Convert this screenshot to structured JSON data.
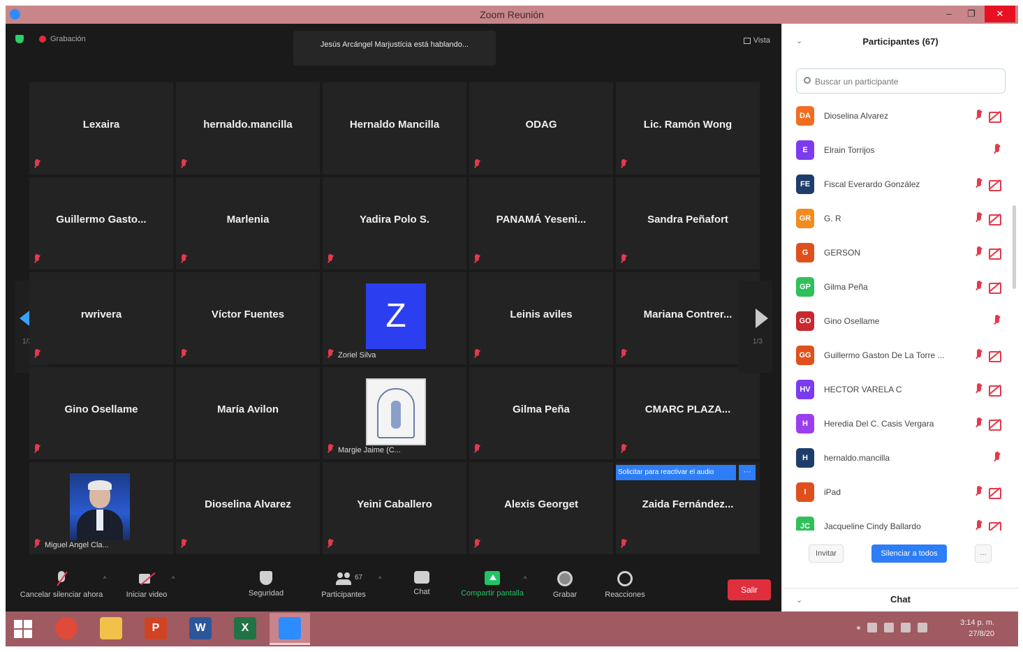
{
  "window": {
    "title": "Zoom Reunión",
    "minimize": "–",
    "restore": "❐",
    "close": "✕"
  },
  "meeting": {
    "recording_label": "Grabación",
    "speaker_banner": "Jesús Arcángel Marjustícia está hablando...",
    "view_label": "Vista",
    "page_indicator_prev": "1/3",
    "page_indicator_next": "1/3",
    "tiles": [
      {
        "name": "Lexaira"
      },
      {
        "name": "hernaldo.mancilla"
      },
      {
        "name": "Hernaldo Mancilla"
      },
      {
        "name": "ODAG"
      },
      {
        "name": "Lic. Ramón Wong"
      },
      {
        "name": "Guillermo Gasto..."
      },
      {
        "name": "Marlenia"
      },
      {
        "name": "Yadira Polo S."
      },
      {
        "name": "PANAMÁ Yeseni..."
      },
      {
        "name": "Sandra Peñafort"
      },
      {
        "name": "rwrivera"
      },
      {
        "name": "Víctor Fuentes"
      },
      {
        "avatar_letter": "Z",
        "small_name": "Zoriel Silva"
      },
      {
        "name": "Leinis aviles"
      },
      {
        "name": "Mariana Contrer..."
      },
      {
        "name": "Gino Osellame"
      },
      {
        "name": "María Avilon"
      },
      {
        "small_name": "Margie Jaime (C..."
      },
      {
        "name": "Gilma Peña"
      },
      {
        "name": "CMARC PLAZA..."
      },
      {
        "small_name": "Miguel Angel Cla..."
      },
      {
        "name": "Dioselina Alvarez"
      },
      {
        "name": "Yeini Caballero"
      },
      {
        "name": "Alexis Georget"
      },
      {
        "name": "Zaida Fernández...",
        "request_text": "Solicitar para reactivar el audio",
        "request_more": "···"
      }
    ]
  },
  "toolbar": {
    "mute_label": "Cancelar silenciar ahora",
    "video_label": "Iniciar video",
    "security_label": "Seguridad",
    "participants_label": "Participantes",
    "participants_count": "67",
    "chat_label": "Chat",
    "share_label": "Compartir pantalla",
    "record_label": "Grabar",
    "reactions_label": "Reacciones",
    "leave_label": "Salir",
    "caret": "^"
  },
  "panel": {
    "chevron": "⌄",
    "title": "Participantes (67)",
    "search_placeholder": "Buscar un participante",
    "participants": [
      {
        "initials": "DA",
        "name": "Dioselina Alvarez",
        "color": "#f26d21",
        "video_off": true
      },
      {
        "initials": "E",
        "name": "Elrain Torrijos",
        "color": "#7b3cf0",
        "video_off": false
      },
      {
        "initials": "FE",
        "name": "Fiscal Everardo González",
        "color": "#1f3d6b",
        "video_off": true
      },
      {
        "initials": "GR",
        "name": "G. R",
        "color": "#f28c1e",
        "video_off": true
      },
      {
        "initials": "G",
        "name": "GERSON",
        "color": "#e0501c",
        "video_off": true
      },
      {
        "initials": "GP",
        "name": "Gilma Peña",
        "color": "#2fc05a",
        "video_off": true
      },
      {
        "initials": "GO",
        "name": "Gino Osellame",
        "color": "#c8282e",
        "video_off": false
      },
      {
        "initials": "GG",
        "name": "Guillermo Gaston De La Torre ...",
        "color": "#e0501c",
        "video_off": true
      },
      {
        "initials": "HV",
        "name": "HECTOR VARELA C",
        "color": "#7b3cf0",
        "video_off": true
      },
      {
        "initials": "H",
        "name": "Heredia Del C. Casis Vergara",
        "color": "#9b3ef0",
        "video_off": true
      },
      {
        "initials": "H",
        "name": "hernaldo.mancilla",
        "color": "#1f3d6b",
        "video_off": false
      },
      {
        "initials": "I",
        "name": "iPad",
        "color": "#e0501c",
        "video_off": true
      },
      {
        "initials": "JC",
        "name": "Jacqueline Cindy Ballardo",
        "color": "#2fc05a",
        "video_off": true
      }
    ],
    "invite_label": "Invitar",
    "mute_all_label": "Silenciar a todos",
    "more_label": "...",
    "chat_title": "Chat"
  },
  "taskbar": {
    "apps": [
      {
        "name": "Chrome",
        "glyph": "",
        "color": "#e04a3a"
      },
      {
        "name": "Explorador",
        "glyph": "",
        "color": "#f1c14a"
      },
      {
        "name": "PowerPoint",
        "glyph": "P",
        "color": "#d04423"
      },
      {
        "name": "Word",
        "glyph": "W",
        "color": "#2b579a"
      },
      {
        "name": "Excel",
        "glyph": "X",
        "color": "#217346"
      },
      {
        "name": "Zoom",
        "glyph": "",
        "color": "#2d8cff"
      }
    ],
    "time": "3:14 p. m.",
    "date": "27/8/20"
  }
}
